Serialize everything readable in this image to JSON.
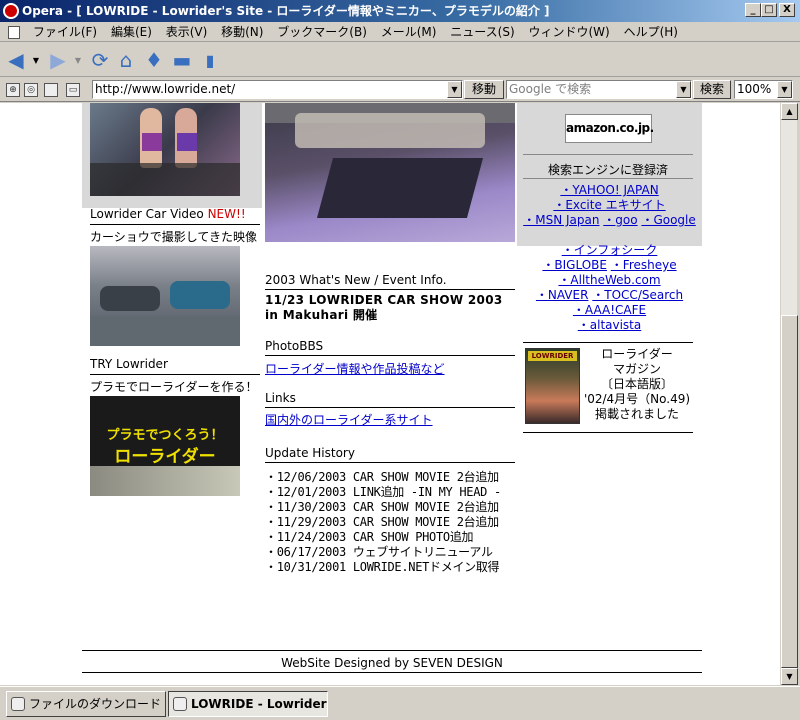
{
  "window": {
    "title": "Opera - [ LOWRIDE - Lowrider's Site - ローライダー情報やミニカー、プラモデルの紹介 ]",
    "minimize": "_",
    "maximize": "□",
    "close": "X"
  },
  "menu": [
    "ファイル(F)",
    "編集(E)",
    "表示(V)",
    "移動(N)",
    "ブックマーク(B)",
    "メール(M)",
    "ニュース(S)",
    "ウィンドウ(W)",
    "ヘルプ(H)"
  ],
  "address": {
    "url": "http://www.lowride.net/",
    "go_label": "移動",
    "search_placeholder": "Google で検索",
    "search_label": "検索",
    "zoom": "100%"
  },
  "left": {
    "video_heading": "Lowrider Car Video",
    "video_new": "NEW!!",
    "video_caption": "カーショウで撮影してきた映像",
    "try_heading": "TRY Lowrider",
    "try_caption": "プラモでローライダーを作る！",
    "promo_line1": "プラモでつくろう！",
    "promo_line2": "ローライダー"
  },
  "center": {
    "whatsnew_heading": "2003 What's New / Event Info.",
    "event_title": "11/23 LOWRIDER CAR SHOW 2003 in Makuhari 開催",
    "photobbs_heading": "PhotoBBS",
    "photobbs_link": "ローライダー情報や作品投稿など",
    "links_heading": "Links",
    "links_link": "国内外のローライダー系サイト",
    "update_heading": "Update History",
    "updates": [
      "・12/06/2003 CAR SHOW MOVIE 2台追加",
      "・12/01/2003 LINK追加 -IN MY HEAD -",
      "・11/30/2003 CAR SHOW MOVIE 2台追加",
      "・11/29/2003 CAR SHOW MOVIE 2台追加",
      "・11/24/2003 CAR SHOW PHOTO追加",
      "・06/17/2003 ウェブサイトリニューアル",
      "・10/31/2001 LOWRIDE.NETドメイン取得"
    ]
  },
  "right": {
    "amazon_logo": "amazon.co.jp.",
    "search_engine_heading": "検索エンジンに登録済",
    "engines": {
      "yahoo": "・YAHOO! JAPAN",
      "excite": "・Excite エキサイト",
      "msn": "・MSN Japan",
      "goo": "・goo",
      "google": "・Google",
      "infoseek": "・インフォシーク",
      "biglobe": "・BIGLOBE",
      "fresheye": "・Fresheye",
      "alltheweb": "・AlltheWeb.com",
      "naver": "・NAVER",
      "tocc": "・TOCC/Search",
      "aaacafe": "・AAA!CAFE",
      "altavista": "・altavista"
    },
    "magazine_lines": [
      "ローライダー",
      "マガジン",
      "〔日本語版〕",
      "'02/4月号（No.49)",
      "掲載されました"
    ],
    "magazine_cover_text": "LOWRIDER"
  },
  "footer": "WebSite Designed by SEVEN DESIGN",
  "taskbar": {
    "downloads": "ファイルのダウンロード",
    "active_tab": "LOWRIDE - Lowrider'..."
  },
  "colors": {
    "new_badge": "#cc0000",
    "link": "#0000cc",
    "titlebar": "#0a246a",
    "promo_text": "#f0e000"
  }
}
